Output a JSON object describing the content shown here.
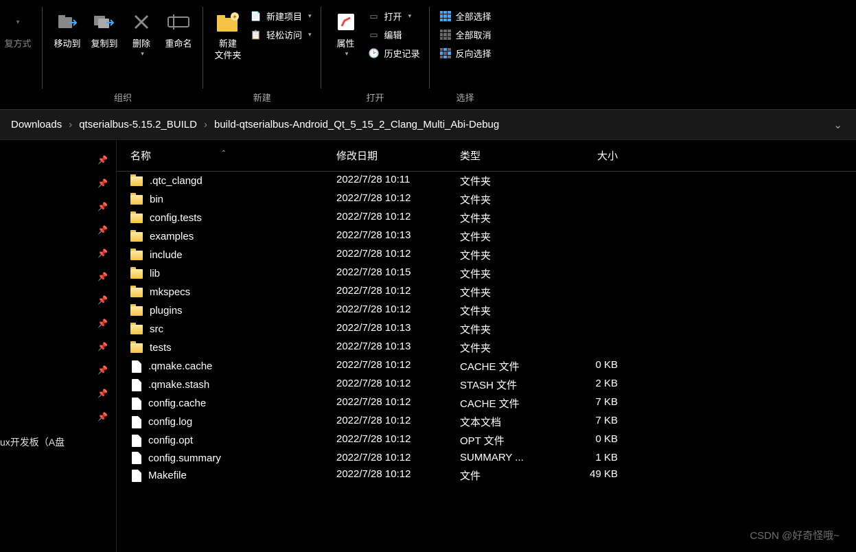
{
  "ribbon": {
    "groups": [
      {
        "label": "组织",
        "large": [
          {
            "name": "move-to-button",
            "label": "移动到",
            "icon": "move"
          },
          {
            "name": "copy-to-button",
            "label": "复制到",
            "icon": "copy"
          },
          {
            "name": "delete-button",
            "label": "删除",
            "icon": "delete"
          },
          {
            "name": "rename-button",
            "label": "重命名",
            "icon": "rename"
          }
        ],
        "left_partial": "复方式"
      },
      {
        "label": "新建",
        "large": [
          {
            "name": "new-folder-button",
            "label": "新建\n文件夹",
            "icon": "newfolder"
          }
        ],
        "small": [
          {
            "name": "new-item-menu",
            "label": "新建项目",
            "icon": "newitem",
            "dropdown": true
          },
          {
            "name": "easy-access-menu",
            "label": "轻松访问",
            "icon": "easyaccess",
            "dropdown": true
          }
        ]
      },
      {
        "label": "打开",
        "large": [
          {
            "name": "properties-button",
            "label": "属性",
            "icon": "properties"
          }
        ],
        "small": [
          {
            "name": "open-menu",
            "label": "打开",
            "icon": "open",
            "dropdown": true
          },
          {
            "name": "edit-button",
            "label": "编辑",
            "icon": "edit"
          },
          {
            "name": "history-button",
            "label": "历史记录",
            "icon": "history"
          }
        ]
      },
      {
        "label": "选择",
        "small": [
          {
            "name": "select-all-button",
            "label": "全部选择",
            "icon": "selectall"
          },
          {
            "name": "select-none-button",
            "label": "全部取消",
            "icon": "selectnone"
          },
          {
            "name": "invert-selection-button",
            "label": "反向选择",
            "icon": "selectinv"
          }
        ]
      }
    ]
  },
  "breadcrumb": {
    "items": [
      "Downloads",
      "qtserialbus-5.15.2_BUILD",
      "build-qtserialbus-Android_Qt_5_15_2_Clang_Multi_Abi-Debug"
    ]
  },
  "sidebar": {
    "visible_item": "ux开发板（A盘"
  },
  "columns": {
    "name": "名称",
    "modified": "修改日期",
    "type": "类型",
    "size": "大小"
  },
  "files": [
    {
      "name": ".qtc_clangd",
      "date": "2022/7/28 10:11",
      "type": "文件夹",
      "size": "",
      "kind": "folder"
    },
    {
      "name": "bin",
      "date": "2022/7/28 10:12",
      "type": "文件夹",
      "size": "",
      "kind": "folder"
    },
    {
      "name": "config.tests",
      "date": "2022/7/28 10:12",
      "type": "文件夹",
      "size": "",
      "kind": "folder"
    },
    {
      "name": "examples",
      "date": "2022/7/28 10:13",
      "type": "文件夹",
      "size": "",
      "kind": "folder"
    },
    {
      "name": "include",
      "date": "2022/7/28 10:12",
      "type": "文件夹",
      "size": "",
      "kind": "folder"
    },
    {
      "name": "lib",
      "date": "2022/7/28 10:15",
      "type": "文件夹",
      "size": "",
      "kind": "folder"
    },
    {
      "name": "mkspecs",
      "date": "2022/7/28 10:12",
      "type": "文件夹",
      "size": "",
      "kind": "folder"
    },
    {
      "name": "plugins",
      "date": "2022/7/28 10:12",
      "type": "文件夹",
      "size": "",
      "kind": "folder"
    },
    {
      "name": "src",
      "date": "2022/7/28 10:13",
      "type": "文件夹",
      "size": "",
      "kind": "folder"
    },
    {
      "name": "tests",
      "date": "2022/7/28 10:13",
      "type": "文件夹",
      "size": "",
      "kind": "folder"
    },
    {
      "name": ".qmake.cache",
      "date": "2022/7/28 10:12",
      "type": "CACHE 文件",
      "size": "0 KB",
      "kind": "file"
    },
    {
      "name": ".qmake.stash",
      "date": "2022/7/28 10:12",
      "type": "STASH 文件",
      "size": "2 KB",
      "kind": "file"
    },
    {
      "name": "config.cache",
      "date": "2022/7/28 10:12",
      "type": "CACHE 文件",
      "size": "7 KB",
      "kind": "file"
    },
    {
      "name": "config.log",
      "date": "2022/7/28 10:12",
      "type": "文本文档",
      "size": "7 KB",
      "kind": "file"
    },
    {
      "name": "config.opt",
      "date": "2022/7/28 10:12",
      "type": "OPT 文件",
      "size": "0 KB",
      "kind": "file"
    },
    {
      "name": "config.summary",
      "date": "2022/7/28 10:12",
      "type": "SUMMARY ...",
      "size": "1 KB",
      "kind": "file"
    },
    {
      "name": "Makefile",
      "date": "2022/7/28 10:12",
      "type": "文件",
      "size": "49 KB",
      "kind": "file"
    }
  ],
  "watermark": "CSDN @好奇怪哦~"
}
